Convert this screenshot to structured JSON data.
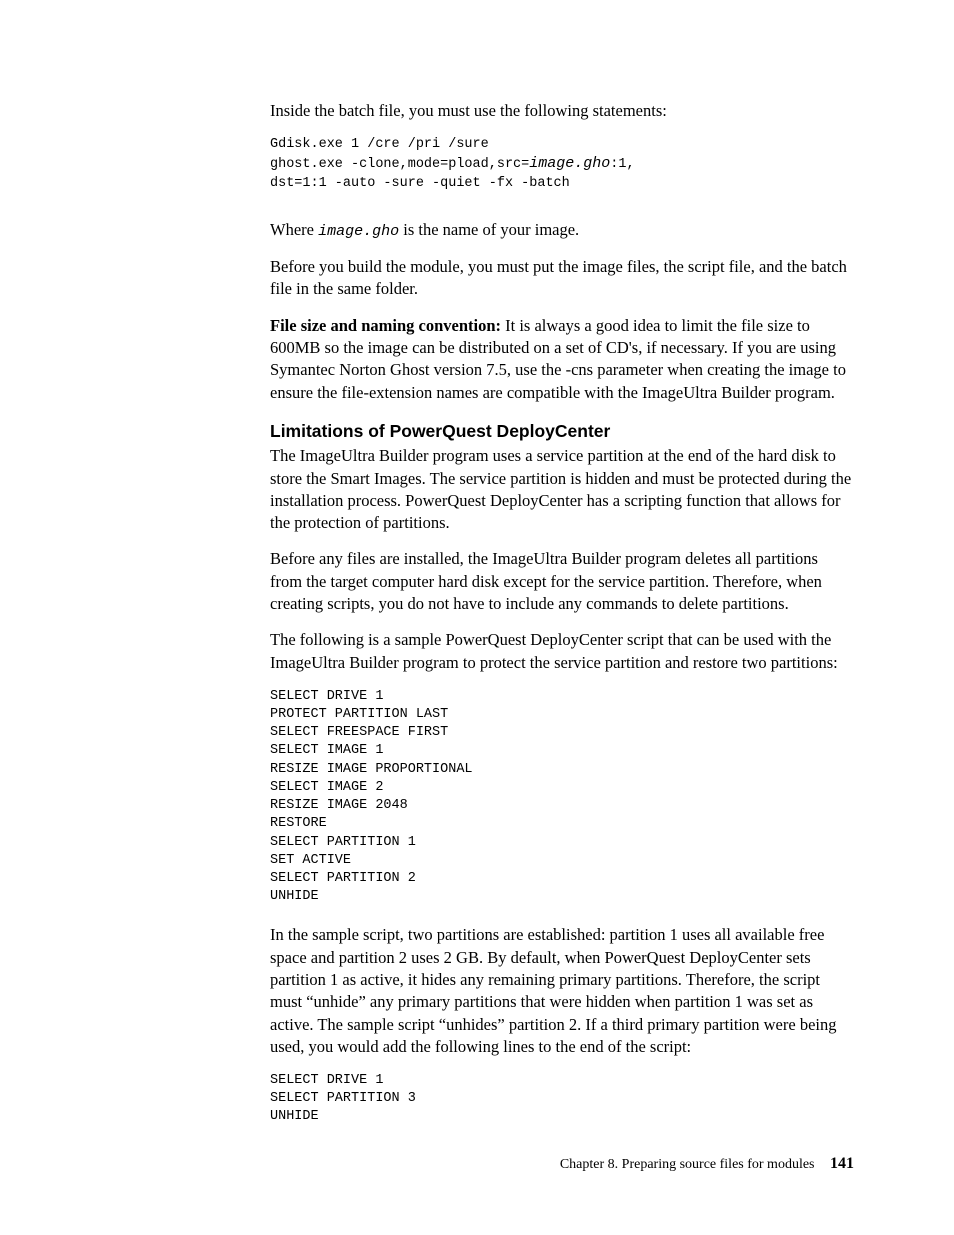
{
  "p1": "Inside the batch file, you must use the following statements:",
  "code1_line1a": "Gdisk.exe 1 /cre /pri /sure",
  "code1_line2a": "ghost.exe -clone,mode=pload,src=",
  "code1_line2b": "image.gho",
  "code1_line2c": ":1,",
  "code1_line3a": "dst=1:1 -auto -sure -quiet -fx -batch",
  "p2a": "Where ",
  "p2b": "image.gho",
  "p2c": " is the name of your image.",
  "p3": "Before you build the module, you must put the image files, the script file, and the batch file in the same folder.",
  "p4a": "File size and naming convention:",
  "p4b": "  It is always a good idea to limit the file size to 600MB so the image can be distributed on a set of CD's, if necessary. If you are using Symantec Norton Ghost version 7.5, use the -cns parameter when creating the image to ensure the file-extension names are compatible with the ImageUltra Builder program.",
  "h2": "Limitations of PowerQuest DeployCenter",
  "p5": "The ImageUltra Builder program uses a service partition at the end of the hard disk to store the Smart Images. The service partition is hidden and must be protected during the installation process. PowerQuest DeployCenter has a scripting function that allows for the protection of partitions.",
  "p6": "Before any files are installed, the ImageUltra Builder program deletes all partitions from the target computer hard disk except for the service partition. Therefore, when creating scripts, you do not have to include any commands to delete partitions.",
  "p7": "The following is a sample PowerQuest DeployCenter script that can be used with the ImageUltra Builder program to protect the service partition and restore two partitions:",
  "code2": "SELECT DRIVE 1\nPROTECT PARTITION LAST\nSELECT FREESPACE FIRST\nSELECT IMAGE 1\nRESIZE IMAGE PROPORTIONAL\nSELECT IMAGE 2\nRESIZE IMAGE 2048\nRESTORE\nSELECT PARTITION 1\nSET ACTIVE\nSELECT PARTITION 2\nUNHIDE",
  "p8": "In the sample script, two partitions are established: partition 1 uses all available free space and partition 2 uses 2 GB. By default, when PowerQuest DeployCenter sets partition 1 as active, it hides any remaining primary partitions. Therefore, the script must “unhide” any primary partitions that were hidden when partition 1 was set as active. The sample script “unhides” partition 2. If a third primary partition were being used, you would add the following lines to the end of the script:",
  "code3": "SELECT DRIVE 1\nSELECT PARTITION 3\nUNHIDE",
  "footer_chapter": "Chapter 8. Preparing source files for modules",
  "footer_page": "141"
}
